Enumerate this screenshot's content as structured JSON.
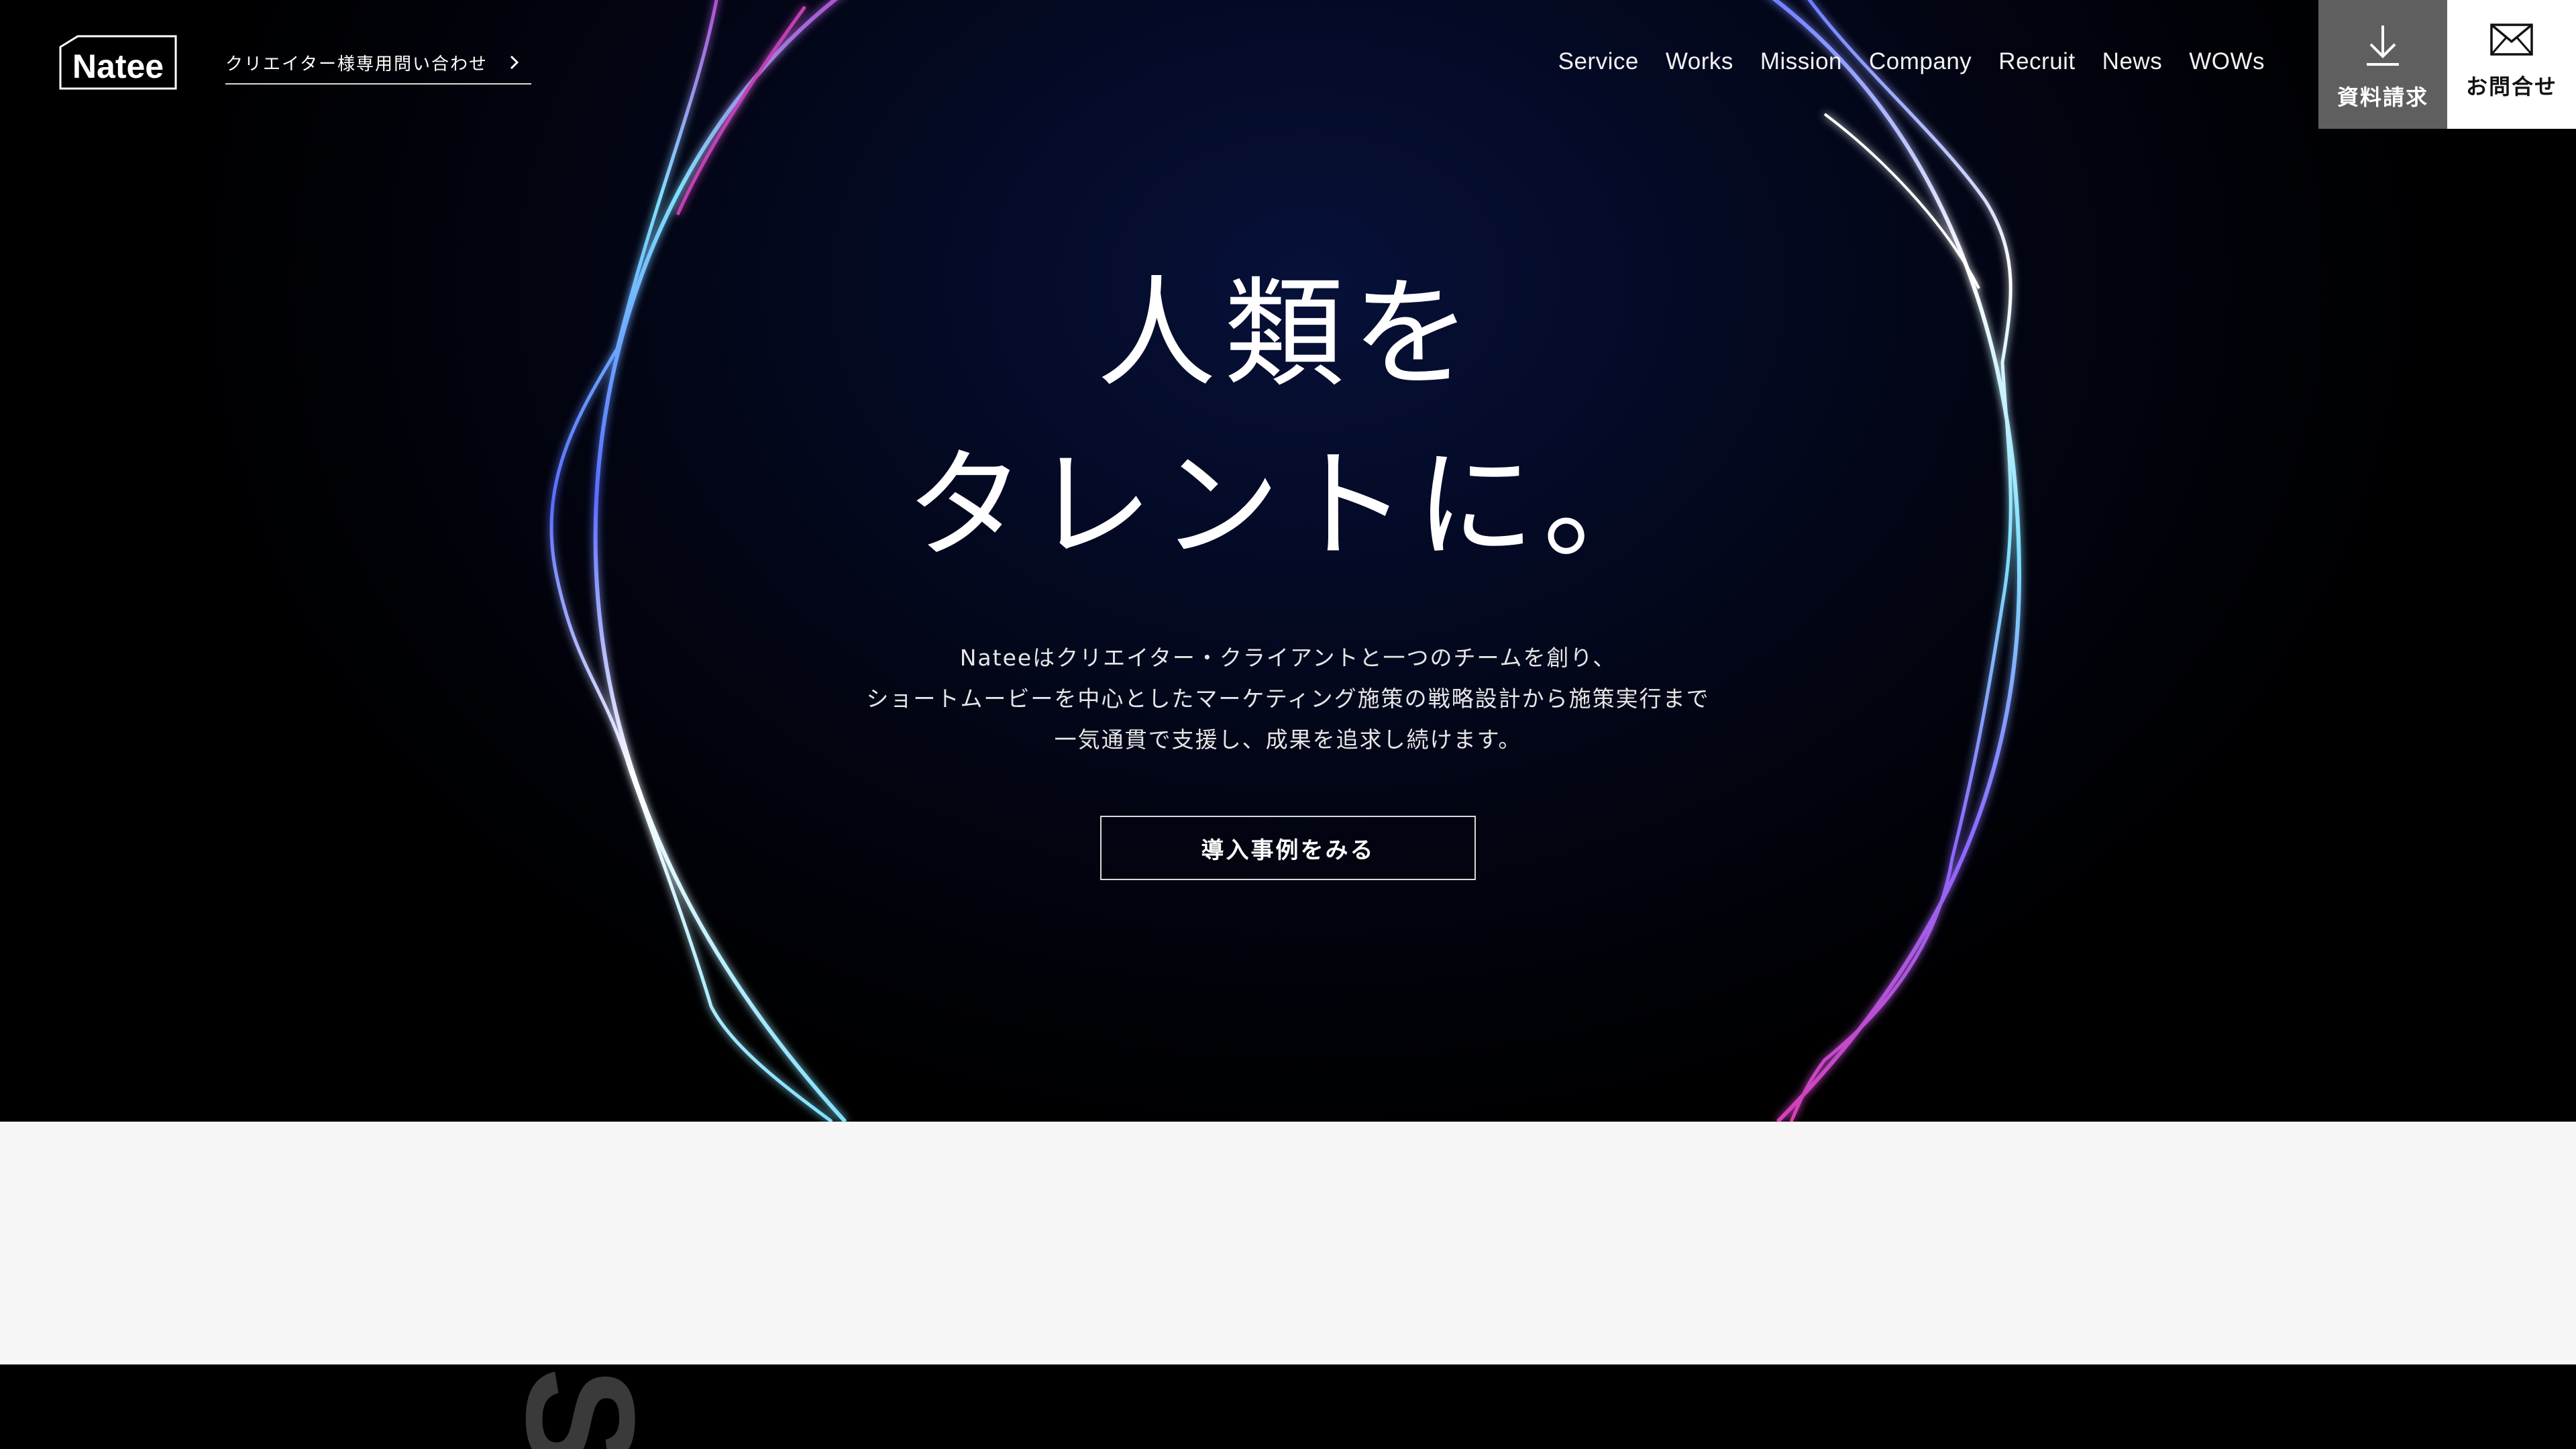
{
  "header": {
    "logo_text": "Natee",
    "creator_link_label": "クリエイター様専用問い合わせ",
    "nav": [
      "Service",
      "Works",
      "Mission",
      "Company",
      "Recruit",
      "News",
      "WOWs"
    ],
    "cta_download_label": "資料請求",
    "cta_contact_label": "お問合せ",
    "icons": {
      "creator_arrow": "chevron-right-icon",
      "download": "download-arrow-icon",
      "contact": "envelope-icon"
    }
  },
  "hero": {
    "headline_line1": "人類を",
    "headline_line2": "タレントに。",
    "lead_line1": "Nateeはクリエイター・クライアントと一つのチームを創り、",
    "lead_line2": "ショートムービーを中心としたマーケティング施策の戦略設計から施策実行まで",
    "lead_line3": "一気通貫で支援し、成果を追求し続けます。",
    "button_label": "導入事例をみる"
  },
  "bottom": {
    "big_letter": "S"
  },
  "colors": {
    "hero_bg": "#020411",
    "doc_button_bg": "#5f5f5f",
    "contact_button_bg": "#ffffff",
    "light_band": "#f6f6f6",
    "ring_cyan": "#7fe0ff",
    "ring_blue": "#5a6cff",
    "ring_magenta": "#d63fb8"
  }
}
